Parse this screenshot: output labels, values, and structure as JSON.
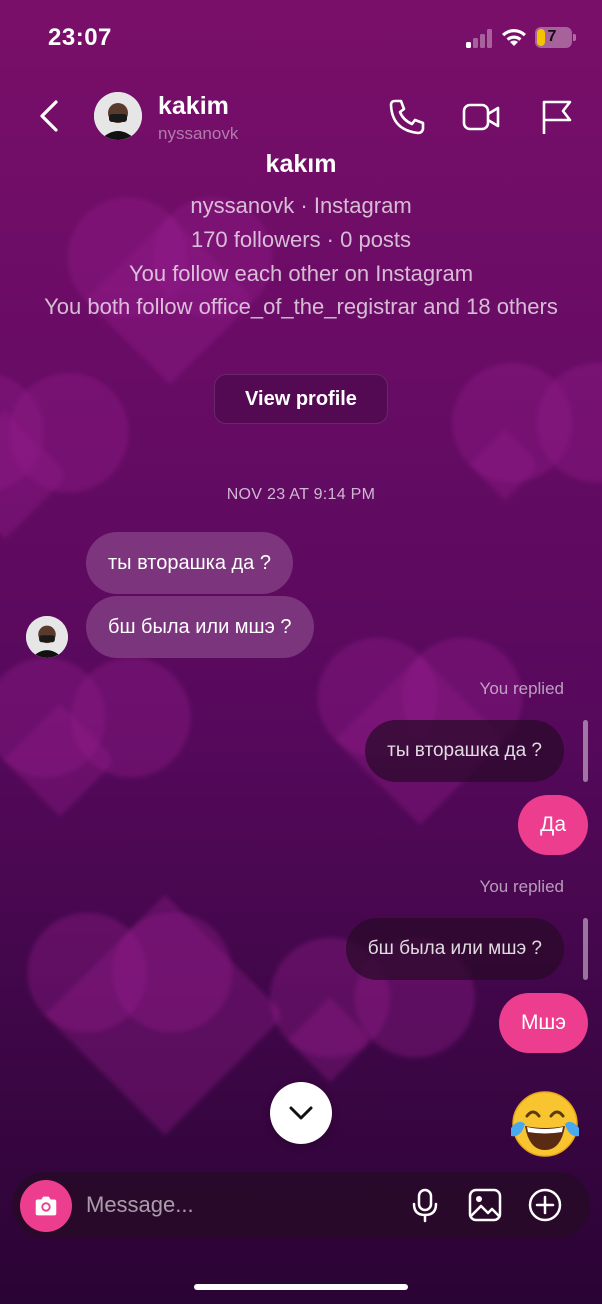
{
  "status_bar": {
    "time": "23:07",
    "battery": "7"
  },
  "header": {
    "name": "kakim",
    "username": "nyssanovk",
    "icons": [
      "back-icon",
      "phone-icon",
      "video-camera-icon",
      "flag-icon"
    ]
  },
  "profile": {
    "name": "kakım",
    "handle_line": "nyssanovk · Instagram",
    "stats_line": "170 followers · 0 posts",
    "follow_line": "You follow each other on Instagram",
    "mutual_line": "You both follow office_of_the_registrar and 18 others",
    "view_profile_label": "View profile"
  },
  "conversation": {
    "date_label": "NOV 23 AT 9:14 PM",
    "incoming": [
      {
        "text": "ты вторашка да ?"
      },
      {
        "text": "бш была или мшэ ?"
      }
    ],
    "replies": [
      {
        "label": "You replied",
        "quoted": "ты вторашка да ?",
        "text": "Да"
      },
      {
        "label": "You replied",
        "quoted": "бш была или мшэ ?",
        "text": "Мшэ"
      }
    ],
    "reaction_emoji": "face-with-tears-of-joy"
  },
  "composer": {
    "placeholder": "Message...",
    "icons": [
      "camera-icon",
      "microphone-icon",
      "gallery-icon",
      "plus-icon"
    ]
  },
  "colors": {
    "accent": "#ec3d8e",
    "background_top": "#7a0f69",
    "background_bottom": "#2a0434"
  }
}
